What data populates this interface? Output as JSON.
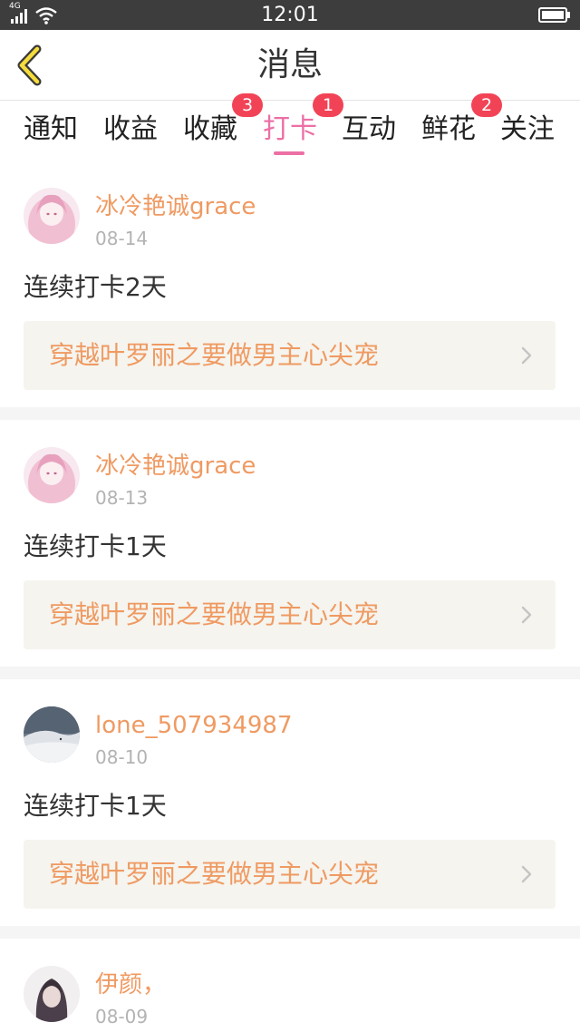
{
  "status_bar": {
    "network": "4G",
    "time": "12:01",
    "icons": [
      "signal-icon",
      "wifi-icon",
      "battery-icon"
    ]
  },
  "header": {
    "back_icon": "chevron-left-icon",
    "title": "消息"
  },
  "tabs": [
    {
      "label": "通知",
      "badge": null,
      "active": false
    },
    {
      "label": "收益",
      "badge": null,
      "active": false
    },
    {
      "label": "收藏",
      "badge": "3",
      "active": false
    },
    {
      "label": "打卡",
      "badge": "1",
      "active": true
    },
    {
      "label": "互动",
      "badge": null,
      "active": false
    },
    {
      "label": "鲜花",
      "badge": "2",
      "active": false
    },
    {
      "label": "关注",
      "badge": null,
      "active": false
    }
  ],
  "feed": [
    {
      "user": "冰冷艳诚grace",
      "date": "08-14",
      "text": "连续打卡2天",
      "book": "穿越叶罗丽之要做男主心尖宠"
    },
    {
      "user": "冰冷艳诚grace",
      "date": "08-13",
      "text": "连续打卡1天",
      "book": "穿越叶罗丽之要做男主心尖宠"
    },
    {
      "user": "lone_507934987",
      "date": "08-10",
      "text": "连续打卡1天",
      "book": "穿越叶罗丽之要做男主心尖宠"
    },
    {
      "user": "伊颜，",
      "date": "08-09"
    }
  ],
  "colors": {
    "accent_pink": "#ec6fa5",
    "name_orange": "#ef9a62",
    "badge_red": "#f24356",
    "back_yellow": "#f5dc3c"
  }
}
